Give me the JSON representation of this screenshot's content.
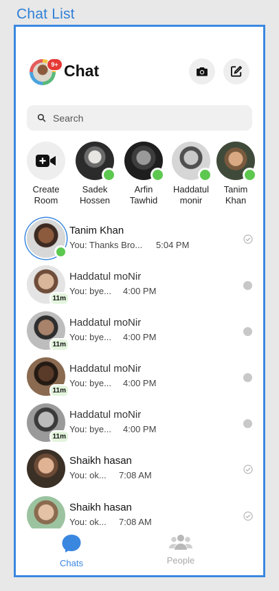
{
  "frame_title": "Chat List",
  "header": {
    "title": "Chat",
    "badge": "9+"
  },
  "search": {
    "placeholder": "Search"
  },
  "stories": [
    {
      "name": "Create Room"
    },
    {
      "name": "Sadek Hossen"
    },
    {
      "name": "Arfin Tawhid"
    },
    {
      "name": "Haddatul monir"
    },
    {
      "name": "Tanim Khan"
    }
  ],
  "chats": [
    {
      "name": "Tanim Khan",
      "preview": "You: Thanks Bro...",
      "time": "5:04 PM",
      "active": "",
      "status": "seen"
    },
    {
      "name": "Haddatul moNir",
      "preview": "You: bye...",
      "time": "4:00 PM",
      "active": "11m",
      "status": "sent"
    },
    {
      "name": "Haddatul moNir",
      "preview": "You: bye...",
      "time": "4:00 PM",
      "active": "11m",
      "status": "sent"
    },
    {
      "name": "Haddatul moNir",
      "preview": "You: bye...",
      "time": "4:00 PM",
      "active": "11m",
      "status": "sent"
    },
    {
      "name": "Haddatul moNir",
      "preview": "You: bye...",
      "time": "4:00 PM",
      "active": "11m",
      "status": "sent"
    },
    {
      "name": "Shaikh hasan",
      "preview": "You: ok...",
      "time": "7:08 AM",
      "active": "",
      "status": "seen"
    },
    {
      "name": "Shaikh hasan",
      "preview": "You: ok...",
      "time": "7:08 AM",
      "active": "",
      "status": "seen"
    }
  ],
  "tabs": {
    "chats": "Chats",
    "people": "People"
  },
  "colors": {
    "accent": "#3a87e0",
    "online": "#5cc84f",
    "badge": "#e53935"
  }
}
